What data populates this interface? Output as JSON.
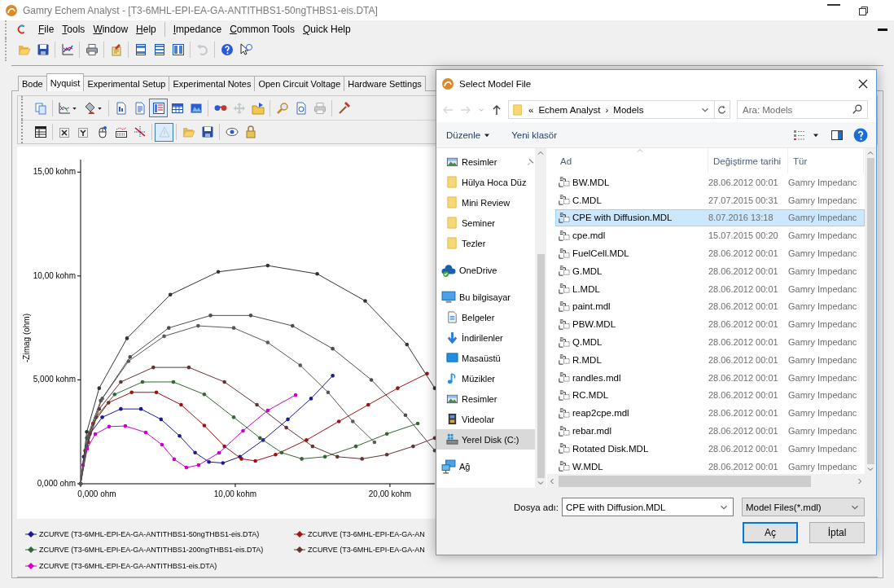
{
  "window": {
    "title": "Gamry Echem Analyst - [T3-6MHL-EPI-EA-GA-ANTITHBS1-50ngTHBS1-eis.DTA]"
  },
  "menu": [
    [
      "File",
      "Tools",
      "Window",
      "Help"
    ],
    [
      "Impedance",
      "Common Tools",
      "Quick Help"
    ]
  ],
  "main_toolbar": [
    {
      "disabled": false
    },
    {
      "disabled": false
    },
    {
      "disabled": false
    },
    {
      "disabled": false
    },
    {
      "disabled": false
    },
    {
      "disabled": false
    },
    {
      "disabled": false
    },
    {
      "disabled": false
    },
    {
      "disabled": true
    },
    {
      "disabled": false
    },
    {
      "disabled": false
    }
  ],
  "tabs": [
    {
      "label": "Bode",
      "selected": false
    },
    {
      "label": "Nyquist",
      "selected": true
    },
    {
      "label": "Experimental Setup",
      "selected": false
    },
    {
      "label": "Experimental Notes",
      "selected": false
    },
    {
      "label": "Open Circuit Voltage",
      "selected": false
    },
    {
      "label": "Hardware Settings",
      "selected": false
    }
  ],
  "plot_toolbar": [
    [
      {
        "pressed": false,
        "disabled": false
      },
      {
        "pressed": false,
        "disabled": false
      },
      {
        "pressed": false,
        "disabled": false
      },
      {
        "pressed": false,
        "disabled": false
      },
      {
        "pressed": false,
        "disabled": false
      },
      {
        "pressed": true,
        "disabled": false
      },
      {
        "pressed": false,
        "disabled": false
      },
      {
        "pressed": false,
        "disabled": false
      },
      {
        "pressed": false,
        "disabled": false
      },
      {
        "pressed": false,
        "disabled": true
      },
      {
        "pressed": false,
        "disabled": false
      },
      {
        "pressed": false,
        "disabled": false
      },
      {
        "pressed": false,
        "disabled": false
      },
      {
        "pressed": false,
        "disabled": true
      },
      {
        "pressed": false,
        "disabled": false
      }
    ],
    [
      {
        "pressed": false,
        "disabled": false
      },
      {
        "pressed": false,
        "disabled": false
      },
      {
        "pressed": false,
        "disabled": false
      },
      {
        "pressed": false,
        "disabled": false
      },
      {
        "pressed": false,
        "disabled": false
      },
      {
        "pressed": false,
        "disabled": false
      },
      {
        "pressed": true,
        "disabled": true
      },
      {
        "pressed": false,
        "disabled": false
      },
      {
        "pressed": false,
        "disabled": false
      },
      {
        "pressed": false,
        "disabled": false
      },
      {
        "pressed": false,
        "disabled": false
      }
    ]
  ],
  "chart_data": {
    "type": "line",
    "ylabel": "-Zimag (ohm)",
    "xlim": [
      0,
      22.9
    ],
    "ylim": [
      0,
      15.6
    ],
    "xticks": [
      {
        "value": 0,
        "label": "0,000 ohm"
      },
      {
        "value": 10,
        "label": "10,00 kohm"
      },
      {
        "value": 20,
        "label": "20,00 kohm"
      }
    ],
    "yticks": [
      {
        "value": 0,
        "label": "0,000 ohm"
      },
      {
        "value": 5,
        "label": "5,000 kohm"
      },
      {
        "value": 10,
        "label": "10,00 kohm"
      },
      {
        "value": 15,
        "label": "15,00 kohm"
      }
    ],
    "series": [
      {
        "name": "ZCURVE (T3-6MHL-EPI-EA-GA-ANTITHBS1-50ngTHBS1-eis.DTA)",
        "color": "#1a1a99",
        "x": [
          0,
          0.2,
          0.6,
          1.4,
          2.6,
          3.9,
          5.2,
          6.4,
          7.4,
          8.3,
          9.2,
          10.3,
          11.8,
          13.4,
          14.9,
          16.3
        ],
        "values": [
          0,
          1.3,
          2.4,
          3.2,
          3.6,
          3.6,
          3.1,
          2.3,
          1.5,
          1.05,
          1.0,
          1.3,
          2.1,
          3.1,
          4.1,
          5.2
        ]
      },
      {
        "name": "ZCURVE (T3-6MHL-EPI-EA-GA-AN",
        "color": "#a01010",
        "x": [
          0,
          0.3,
          0.8,
          1.8,
          3.3,
          4.9,
          6.5,
          8.0,
          9.3,
          10.4,
          11.3,
          12.6,
          14.6,
          16.7,
          18.6,
          20.5,
          22.4
        ],
        "values": [
          0,
          1.6,
          2.9,
          3.9,
          4.4,
          4.4,
          3.8,
          2.8,
          1.8,
          1.2,
          1.1,
          1.4,
          2.1,
          3.0,
          3.8,
          4.6,
          5.3
        ]
      },
      {
        "name": "ZCURVE (T3-6MHL-EPI-EA-GA-ANTITHBS1-200ngTHBS1-eis.DTA)",
        "color": "#336633",
        "x": [
          0,
          0.4,
          1.0,
          2.2,
          4.0,
          6.0,
          8.0,
          9.9,
          11.6,
          13.0,
          14.3,
          15.8,
          17.8,
          19.8,
          21.8
        ],
        "values": [
          0,
          1.8,
          3.2,
          4.3,
          4.9,
          4.9,
          4.3,
          3.2,
          2.2,
          1.5,
          1.2,
          1.3,
          1.8,
          2.4,
          2.9
        ]
      },
      {
        "name": "ZCURVE (T3-6MHL-EPI-EA-GA-AN",
        "color": "#663333",
        "x": [
          0,
          0.5,
          1.2,
          2.6,
          4.7,
          7.0,
          9.3,
          11.4,
          13.3,
          15.0,
          16.6,
          18.2,
          19.8,
          21.5,
          22.9
        ],
        "values": [
          0,
          2.0,
          3.6,
          4.9,
          5.6,
          5.6,
          4.9,
          3.8,
          2.7,
          1.8,
          1.3,
          1.2,
          1.4,
          1.8,
          2.2
        ]
      },
      {
        "name": "ZCURVE (T3-6MHL-EPI-EA-GA-ANTITHBS1-eis.DTA)",
        "color": "#cc00cc",
        "x": [
          0,
          0.16,
          0.42,
          0.95,
          1.84,
          2.89,
          4.21,
          5.26,
          6.05,
          6.84,
          7.63,
          8.95,
          10.5,
          12.1,
          13.9
        ],
        "values": [
          0,
          0.9,
          1.69,
          2.39,
          2.75,
          2.78,
          2.47,
          1.88,
          1.18,
          0.78,
          0.9,
          1.49,
          2.55,
          3.53,
          4.27
        ]
      },
      {
        "color": "#333333",
        "x": [
          0,
          0.4,
          1.2,
          3.0,
          5.8,
          8.9,
          12.1,
          15.3,
          18.4,
          21.1,
          22.9
        ],
        "values": [
          0,
          2.5,
          4.6,
          7.0,
          9.1,
          10.2,
          10.5,
          10.1,
          8.8,
          6.7,
          4.6
        ]
      },
      {
        "color": "#4d4d4d",
        "x": [
          0,
          0.4,
          1.3,
          3.2,
          5.7,
          8.4,
          11.0,
          13.7,
          16.3,
          18.8,
          21.0,
          22.9
        ],
        "values": [
          0,
          2.2,
          4.0,
          6.1,
          7.5,
          8.1,
          8.1,
          7.6,
          6.5,
          5.0,
          3.3,
          1.6
        ]
      },
      {
        "color": "#595959",
        "x": [
          0,
          0.5,
          1.4,
          3.1,
          5.4,
          7.6,
          9.9,
          12.1,
          14.2,
          16.0,
          17.6,
          19.0
        ],
        "values": [
          0,
          2.3,
          4.1,
          5.9,
          7.1,
          7.6,
          7.5,
          6.8,
          5.7,
          4.4,
          3.0,
          2.0
        ]
      }
    ]
  },
  "dialog": {
    "title": "Select Model File",
    "navigation": [
      {
        "disabled": true
      },
      {
        "disabled": true
      },
      {
        "disabled": true
      },
      {
        "disabled": false
      }
    ],
    "address": {
      "overflow": "«",
      "folder": "Echem Analyst",
      "separator": "›",
      "current": "Models"
    },
    "search": {
      "placeholder": "Ara: Models"
    },
    "commands": {
      "organize": "Düzenle",
      "new_folder": "Yeni klasör"
    },
    "nav_pane": {
      "quick_access": [
        {
          "label": "Resimler",
          "kind": "pictures",
          "pinned": true,
          "selected": false
        },
        {
          "label": "Hülya Hoca Düz",
          "kind": "folder",
          "pinned": false,
          "selected": false
        },
        {
          "label": "Mini Review",
          "kind": "folder",
          "pinned": false,
          "selected": false
        },
        {
          "label": "Seminer",
          "kind": "folder",
          "pinned": false,
          "selected": false
        },
        {
          "label": "Tezler",
          "kind": "folder",
          "pinned": false,
          "selected": false
        }
      ],
      "items": [
        {
          "label": "OneDrive",
          "kind": "cloud",
          "selected": false
        },
        {
          "label": "Bu bilgisayar",
          "kind": "computer",
          "selected": false,
          "children": [
            {
              "label": "Belgeler",
              "kind": "documents",
              "selected": false
            },
            {
              "label": "İndirilenler",
              "kind": "downloads",
              "selected": false
            },
            {
              "label": "Masaüstü",
              "kind": "desktop",
              "selected": false
            },
            {
              "label": "Müzikler",
              "kind": "music",
              "selected": false
            },
            {
              "label": "Resimler",
              "kind": "pictures",
              "selected": false
            },
            {
              "label": "Videolar",
              "kind": "videos",
              "selected": false
            },
            {
              "label": "Yerel Disk (C:)",
              "kind": "drive",
              "selected": true
            }
          ]
        },
        {
          "label": "Ağ",
          "kind": "network",
          "selected": false
        }
      ]
    },
    "columns": [
      {
        "label": "Ad",
        "sorted": true
      },
      {
        "label": "Değiştirme tarihi",
        "sorted": false
      },
      {
        "label": "Tür",
        "sorted": false
      }
    ],
    "files": [
      {
        "name": "BW.MDL",
        "date": "28.06.2012 00:01",
        "type": "Gamry Impedanc",
        "selected": false
      },
      {
        "name": "C.MDL",
        "date": "27.07.2015 00:31",
        "type": "Gamry Impedanc",
        "selected": false
      },
      {
        "name": "CPE with Diffusion.MDL",
        "date": "8.07.2016 13:18",
        "type": "Gamry Impedanc",
        "selected": true
      },
      {
        "name": "cpe.mdl",
        "date": "15.07.2015 00:20",
        "type": "Gamry Impedanc",
        "selected": false
      },
      {
        "name": "FuelCell.MDL",
        "date": "28.06.2012 00:01",
        "type": "Gamry Impedanc",
        "selected": false
      },
      {
        "name": "G.MDL",
        "date": "28.06.2012 00:01",
        "type": "Gamry Impedanc",
        "selected": false
      },
      {
        "name": "L.MDL",
        "date": "28.06.2012 00:01",
        "type": "Gamry Impedanc",
        "selected": false
      },
      {
        "name": "paint.mdl",
        "date": "28.06.2012 00:01",
        "type": "Gamry Impedanc",
        "selected": false
      },
      {
        "name": "PBW.MDL",
        "date": "28.06.2012 00:01",
        "type": "Gamry Impedanc",
        "selected": false
      },
      {
        "name": "Q.MDL",
        "date": "28.06.2012 00:01",
        "type": "Gamry Impedanc",
        "selected": false
      },
      {
        "name": "R.MDL",
        "date": "28.06.2012 00:01",
        "type": "Gamry Impedanc",
        "selected": false
      },
      {
        "name": "randles.mdl",
        "date": "28.06.2012 00:01",
        "type": "Gamry Impedanc",
        "selected": false
      },
      {
        "name": "RC.MDL",
        "date": "28.06.2012 00:01",
        "type": "Gamry Impedanc",
        "selected": false
      },
      {
        "name": "reap2cpe.mdl",
        "date": "28.06.2012 00:01",
        "type": "Gamry Impedanc",
        "selected": false
      },
      {
        "name": "rebar.mdl",
        "date": "28.06.2012 00:01",
        "type": "Gamry Impedanc",
        "selected": false
      },
      {
        "name": "Rotated Disk.MDL",
        "date": "28.06.2012 00:01",
        "type": "Gamry Impedanc",
        "selected": false
      },
      {
        "name": "W.MDL",
        "date": "28.06.2012 00:01",
        "type": "Gamry Impedanc",
        "selected": false
      }
    ],
    "file_name": {
      "label": "Dosya adı:",
      "value": "CPE with Diffusion.MDL"
    },
    "file_type": {
      "value": "Model Files(*.mdl)"
    },
    "buttons": [
      {
        "label": "Aç",
        "default": true
      },
      {
        "label": "İptal",
        "default": false
      }
    ]
  }
}
